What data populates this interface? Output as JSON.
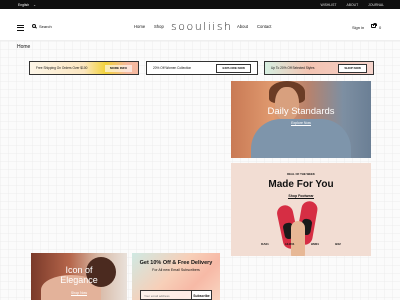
{
  "topbar": {
    "language": "English",
    "links": [
      "WISHLIST",
      "ABOUT",
      "JOURNAL"
    ]
  },
  "header": {
    "search_label": "Search",
    "nav_left": [
      "Home",
      "Shop"
    ],
    "logo": "soouliish",
    "nav_right": [
      "About",
      "Contact"
    ],
    "signin": "Sign in",
    "cart_count": "0"
  },
  "breadcrumb": "Home",
  "promos": [
    {
      "text": "Free Shipping On Orders Over $100",
      "cta": "MORE INFO"
    },
    {
      "text": "20% Off Women Collection",
      "cta": "EXPLORE NOW"
    },
    {
      "text": "Up To 20% Off Selected Styles",
      "cta": "SHOP NOW"
    }
  ],
  "daily": {
    "title": "Daily Standards",
    "link": "Explore Now"
  },
  "made_for_you": {
    "kicker": "DEAL OF THE WEEK",
    "title": "Made For You",
    "link": "Shop Footwear",
    "sizes": [
      "DA01",
      "HH201",
      "HM01",
      "B02"
    ]
  },
  "icon": {
    "title_line1": "Icon of",
    "title_line2": "Elegance",
    "link": "Shop Now"
  },
  "newsletter": {
    "title": "Get 10% Off & Free Delivery",
    "subtitle": "For All new Email Subscribers",
    "email_placeholder": "Your email address",
    "button": "Subscribe"
  },
  "colors": {
    "topbar": "#0f0f0f",
    "accent": "#d62e44"
  },
  "icons": [
    "hamburger-icon",
    "search-icon",
    "cart-icon",
    "chevron-down-icon"
  ]
}
